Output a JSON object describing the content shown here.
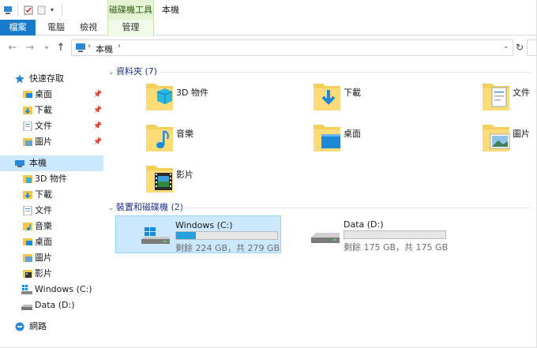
{
  "title_bar": {
    "context_tab_header": "磁碟機工具",
    "window_title": "本機"
  },
  "ribbon": {
    "tabs": [
      {
        "label": "檔案"
      },
      {
        "label": "電腦"
      },
      {
        "label": "檢視"
      },
      {
        "label": "管理"
      }
    ]
  },
  "address_bar": {
    "path": "本機",
    "icon": "computer-icon"
  },
  "sidebar": {
    "quick_access": {
      "label": "快速存取",
      "items": [
        {
          "label": "桌面",
          "icon": "desktop-icon",
          "pinned": true
        },
        {
          "label": "下載",
          "icon": "downloads-icon",
          "pinned": true
        },
        {
          "label": "文件",
          "icon": "documents-icon",
          "pinned": true
        },
        {
          "label": "圖片",
          "icon": "pictures-icon",
          "pinned": true
        }
      ]
    },
    "this_pc": {
      "label": "本機",
      "items": [
        {
          "label": "3D 物件",
          "icon": "3d-objects-icon"
        },
        {
          "label": "下載",
          "icon": "downloads-icon"
        },
        {
          "label": "文件",
          "icon": "documents-icon"
        },
        {
          "label": "音樂",
          "icon": "music-icon"
        },
        {
          "label": "桌面",
          "icon": "desktop-icon"
        },
        {
          "label": "圖片",
          "icon": "pictures-icon"
        },
        {
          "label": "影片",
          "icon": "videos-icon"
        },
        {
          "label": "Windows (C:)",
          "icon": "windows-drive-icon"
        },
        {
          "label": "Data (D:)",
          "icon": "drive-icon"
        }
      ]
    },
    "network": {
      "label": "網路",
      "icon": "network-icon"
    }
  },
  "main": {
    "folders_group": {
      "label": "資料夾 (7)",
      "items": [
        {
          "label": "3D 物件",
          "icon": "3d-objects-folder-icon"
        },
        {
          "label": "下載",
          "icon": "downloads-folder-icon"
        },
        {
          "label": "文件",
          "icon": "documents-folder-icon"
        },
        {
          "label": "音樂",
          "icon": "music-folder-icon"
        },
        {
          "label": "桌面",
          "icon": "desktop-folder-icon"
        },
        {
          "label": "圖片",
          "icon": "pictures-folder-icon"
        },
        {
          "label": "影片",
          "icon": "videos-folder-icon"
        }
      ]
    },
    "drives_group": {
      "label": "裝置和磁碟機 (2)",
      "items": [
        {
          "name": "Windows (C:)",
          "space": "剩餘 224 GB，共 279 GB",
          "used_fraction": 0.197,
          "selected": true
        },
        {
          "name": "Data (D:)",
          "space": "剩餘 175 GB，共 175 GB",
          "used_fraction": 0.0,
          "selected": false
        }
      ]
    }
  },
  "colors": {
    "file_tab": "#1979ca",
    "selection": "#cce8ff",
    "drive_bar": "#26a0da",
    "group_header": "#1e3287",
    "context_tab": "#e3f3d4"
  }
}
